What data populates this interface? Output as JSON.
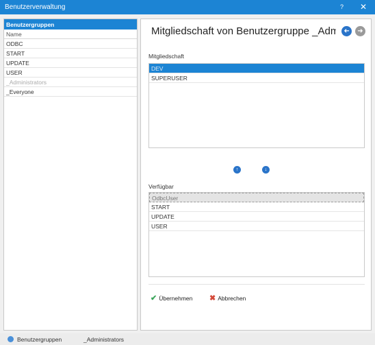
{
  "window": {
    "title": "Benutzerverwaltung",
    "help_label": "?",
    "close_label": "✕"
  },
  "left": {
    "header": "Benutzergruppen",
    "column_header": "Name",
    "rows": [
      "ODBC",
      "START",
      "UPDATE",
      "USER",
      "_Administrators",
      "_Everyone"
    ]
  },
  "main": {
    "title": "Mitgliedschaft von Benutzergruppe _Administrators",
    "nav_back_glyph": "➜",
    "nav_forward_glyph": "➜",
    "membership": {
      "label": "Mitgliedschaft",
      "items": [
        "DEV",
        "SUPERUSER"
      ]
    },
    "move_up_glyph": "↑",
    "move_down_glyph": "↓",
    "available": {
      "label": "Verfügbar",
      "items": [
        "OdbcUser",
        "START",
        "UPDATE",
        "USER"
      ]
    },
    "apply": {
      "label": "Übernehmen",
      "icon": "check-icon",
      "glyph": "✔"
    },
    "cancel": {
      "label": "Abbrechen",
      "icon": "cross-icon",
      "glyph": "✖"
    }
  },
  "statusbar": {
    "section": "Benutzergruppen",
    "current": "_Administrators"
  },
  "colors": {
    "accent": "#1c84d4",
    "apply_green": "#3aa55a",
    "cancel_red": "#d44a3a"
  }
}
